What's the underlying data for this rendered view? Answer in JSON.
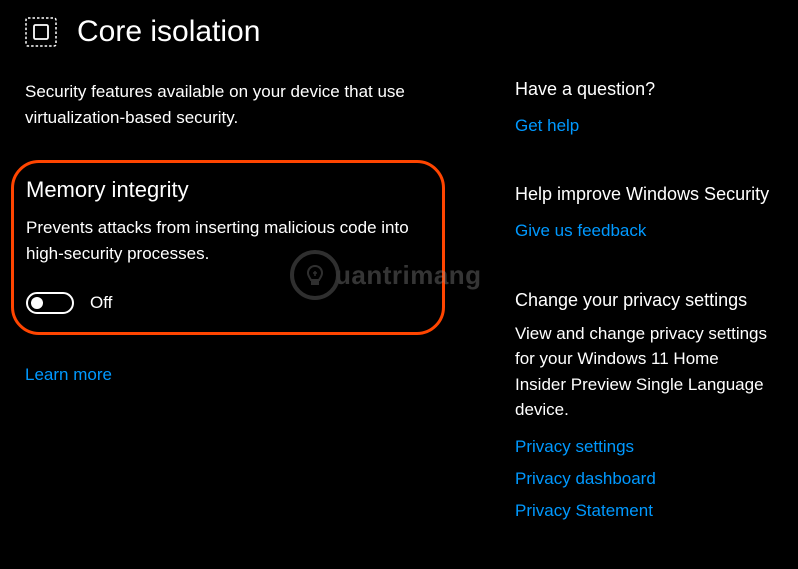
{
  "header": {
    "title": "Core isolation"
  },
  "main": {
    "description": "Security features available on your device that use virtualization-based security.",
    "memory_integrity": {
      "title": "Memory integrity",
      "description": "Prevents attacks from inserting malicious code into high-security processes.",
      "toggle_state": "Off"
    },
    "learn_more": "Learn more"
  },
  "sidebar": {
    "question": {
      "heading": "Have a question?",
      "link": "Get help"
    },
    "improve": {
      "heading": "Help improve Windows Security",
      "link": "Give us feedback"
    },
    "privacy": {
      "heading": "Change your privacy settings",
      "text": "View and change privacy settings for your Windows 11 Home Insider Preview Single Language device.",
      "links": [
        "Privacy settings",
        "Privacy dashboard",
        "Privacy Statement"
      ]
    }
  },
  "watermark": {
    "text": "uantrimang"
  }
}
